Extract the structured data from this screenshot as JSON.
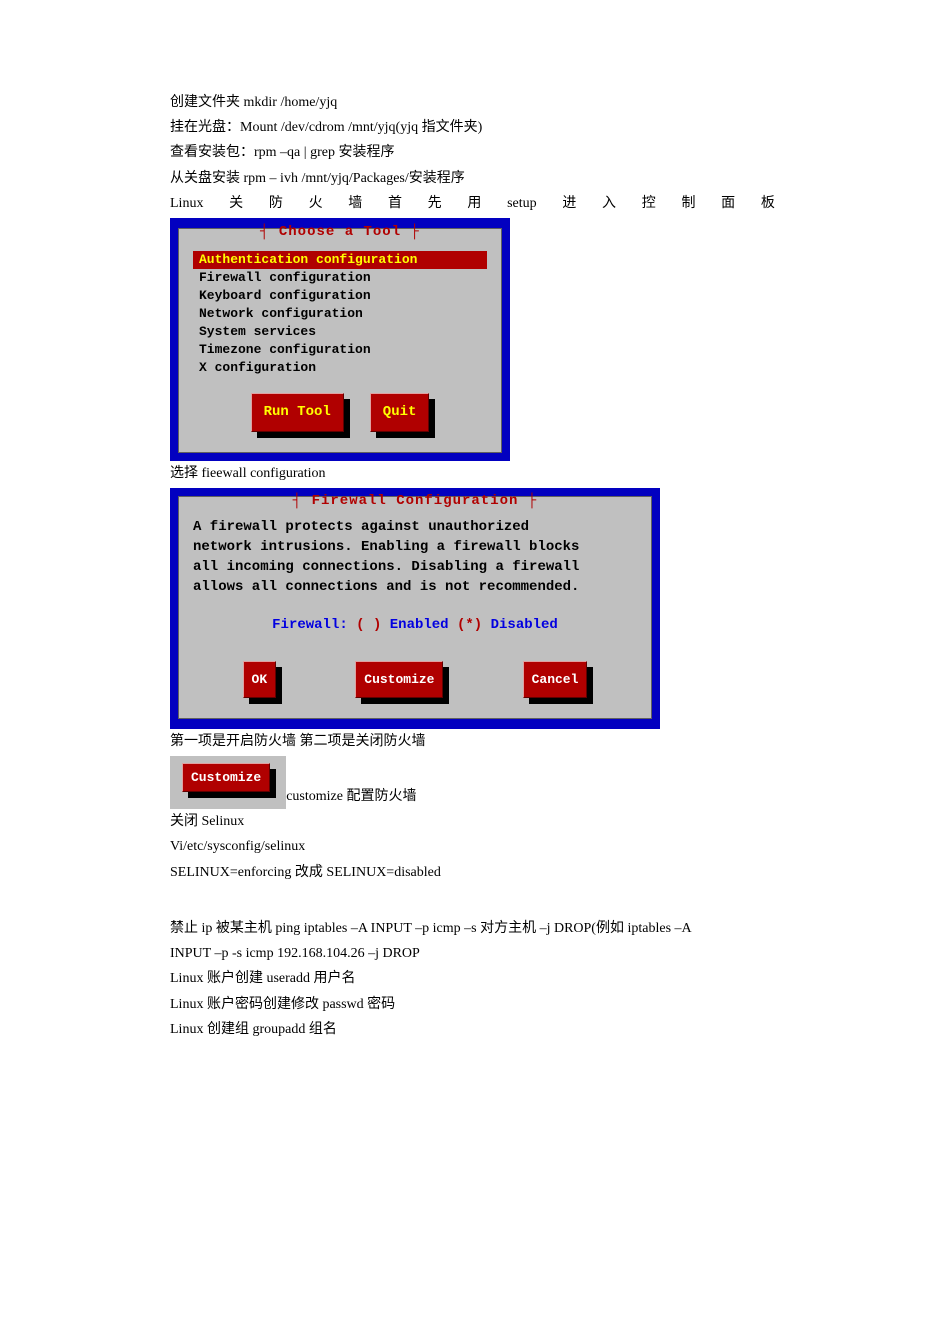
{
  "text": {
    "l1": "创建文件夹 mkdir  /home/yjq",
    "l2": "挂在光盘：Mount  /dev/cdrom  /mnt/yjq(yjq 指文件夹)",
    "l3": "查看安装包：rpm  –qa  |  grep   安装程序",
    "l4": "从关盘安装 rpm  –  ivh  /mnt/yjq/Packages/安装程序",
    "l5a": "Linux",
    "l5b": "关",
    "l5c": "防",
    "l5d": "火",
    "l5e": "墙",
    "l5f": "首",
    "l5g": "先",
    "l5h": "用",
    "l5i": "setup",
    "l5j": "进",
    "l5k": "入",
    "l5l": "控",
    "l5m": "制",
    "l5n": "面",
    "l5o": "板",
    "l6": "选择 fieewall  configuration",
    "l7": "第一项是开启防火墙   第二项是关闭防火墙",
    "l8_suffix": "customize 配置防火墙",
    "l9": "关闭 Selinux",
    "l10": "Vi/etc/sysconfig/selinux",
    "l11": "SELINUX=enforcing   改成 SELINUX=disabled",
    "l12": "禁止 ip 被某主机 ping  iptables  –A INPUT  –p  icmp  –s   对方主机 –j  DROP(例如 iptables   –A",
    "l13": "INPUT  –p  -s  icmp  192.168.104.26  –j  DROP",
    "l14": "Linux 账户创建 useradd   用户名",
    "l15": "Linux   账户密码创建修改  passwd   密码",
    "l16": "Linux   创建组  groupadd   组名"
  },
  "tui1": {
    "title": "┤ Choose a Tool ├",
    "items": [
      "Authentication configuration",
      "Firewall configuration",
      "Keyboard configuration",
      "Network configuration",
      "System services",
      "Timezone configuration",
      "X configuration"
    ],
    "btn_run": "Run Tool",
    "btn_quit": "Quit"
  },
  "tui2": {
    "title": "┤ Firewall Configuration ├",
    "d1": "A firewall protects against unauthorized",
    "d2": "network intrusions. Enabling a firewall blocks",
    "d3": "all incoming connections. Disabling a firewall",
    "d4": "allows all connections and is not recommended.",
    "radio_label": "Firewall: ",
    "radio_en_mark": "( )",
    "radio_en": " Enabled ",
    "radio_di_mark": "(*)",
    "radio_di": " Disabled",
    "btn_ok": "OK",
    "btn_cust": "Customize",
    "btn_cancel": "Cancel"
  },
  "tui3": {
    "btn_cust": "Customize"
  }
}
